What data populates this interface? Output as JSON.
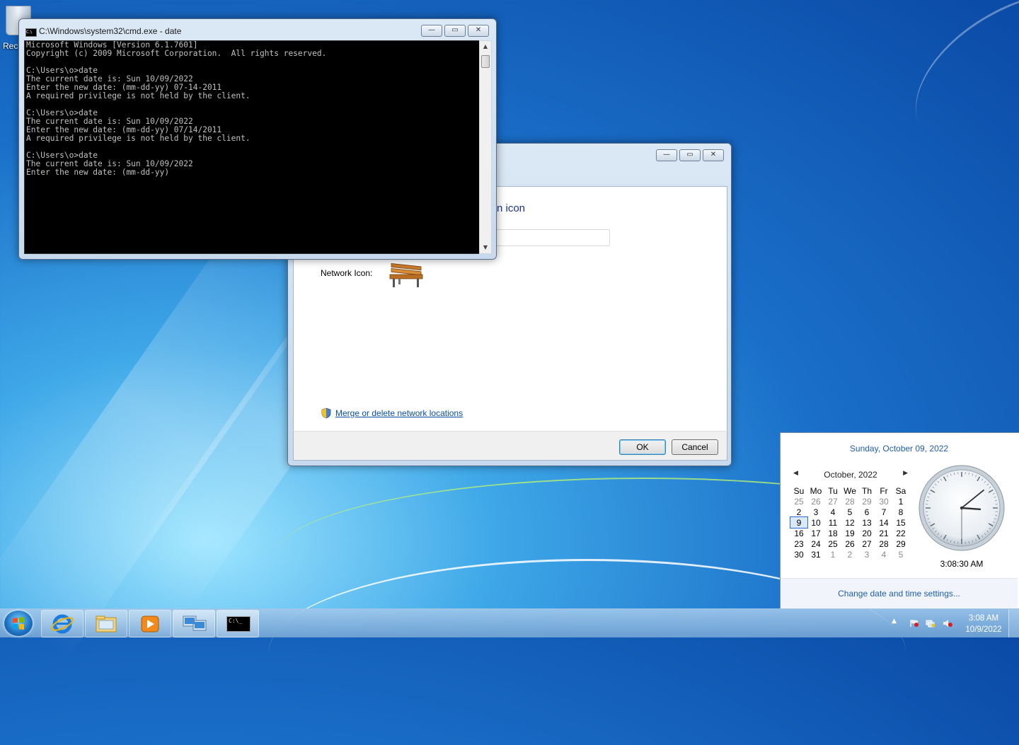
{
  "desktop": {
    "recycle_bin_label": "Rec"
  },
  "cmd_window": {
    "title": "C:\\Windows\\system32\\cmd.exe - date",
    "icon_text": "C:\\",
    "lines": [
      "Microsoft Windows [Version 6.1.7601]",
      "Copyright (c) 2009 Microsoft Corporation.  All rights reserved.",
      "",
      "C:\\Users\\o>date",
      "The current date is: Sun 10/09/2022",
      "Enter the new date: (mm-dd-yy) 07-14-2011",
      "A required privilege is not held by the client.",
      "",
      "C:\\Users\\o>date",
      "The current date is: Sun 10/09/2022",
      "Enter the new date: (mm-dd-yy) 07/14/2011",
      "A required privilege is not held by the client.",
      "",
      "C:\\Users\\o>date",
      "The current date is: Sun 10/09/2022",
      "Enter the new date: (mm-dd-yy)"
    ],
    "controls": {
      "minimize": "—",
      "maximize": "▭",
      "close": "✕"
    }
  },
  "network_dialog": {
    "heading_partial": "n icon",
    "network_icon_label": "Network Icon:",
    "merge_link": "Merge or delete network locations",
    "ok_label": "OK",
    "cancel_label": "Cancel",
    "controls": {
      "minimize": "—",
      "maximize": "▭",
      "close": "✕"
    }
  },
  "clock_flyout": {
    "long_date": "Sunday, October 09, 2022",
    "month_label": "October, 2022",
    "prev": "◀",
    "next": "▶",
    "weekdays": [
      "Su",
      "Mo",
      "Tu",
      "We",
      "Th",
      "Fr",
      "Sa"
    ],
    "weeks": [
      [
        "25",
        "26",
        "27",
        "28",
        "29",
        "30",
        "1"
      ],
      [
        "2",
        "3",
        "4",
        "5",
        "6",
        "7",
        "8"
      ],
      [
        "9",
        "10",
        "11",
        "12",
        "13",
        "14",
        "15"
      ],
      [
        "16",
        "17",
        "18",
        "19",
        "20",
        "21",
        "22"
      ],
      [
        "23",
        "24",
        "25",
        "26",
        "27",
        "28",
        "29"
      ],
      [
        "30",
        "31",
        "1",
        "2",
        "3",
        "4",
        "5"
      ]
    ],
    "today": "9",
    "analog_time": {
      "hour": 3,
      "minute": 8,
      "second": 30
    },
    "time_text": "3:08:30 AM",
    "settings_link": "Change date and time settings..."
  },
  "taskbar": {
    "pinned": [
      "internet-explorer-icon",
      "windows-explorer-icon",
      "media-player-icon",
      "network-control-panel-icon",
      "command-prompt-icon"
    ],
    "cmd_icon_text": "C:\\_",
    "tray_time": "3:08 AM",
    "tray_date": "10/9/2022",
    "tray_arrow": "▲"
  },
  "colors": {
    "link_blue": "#1f5cb3",
    "heading_blue": "#1e3287",
    "console_bg": "#000000",
    "console_text": "#c0c0c0"
  }
}
